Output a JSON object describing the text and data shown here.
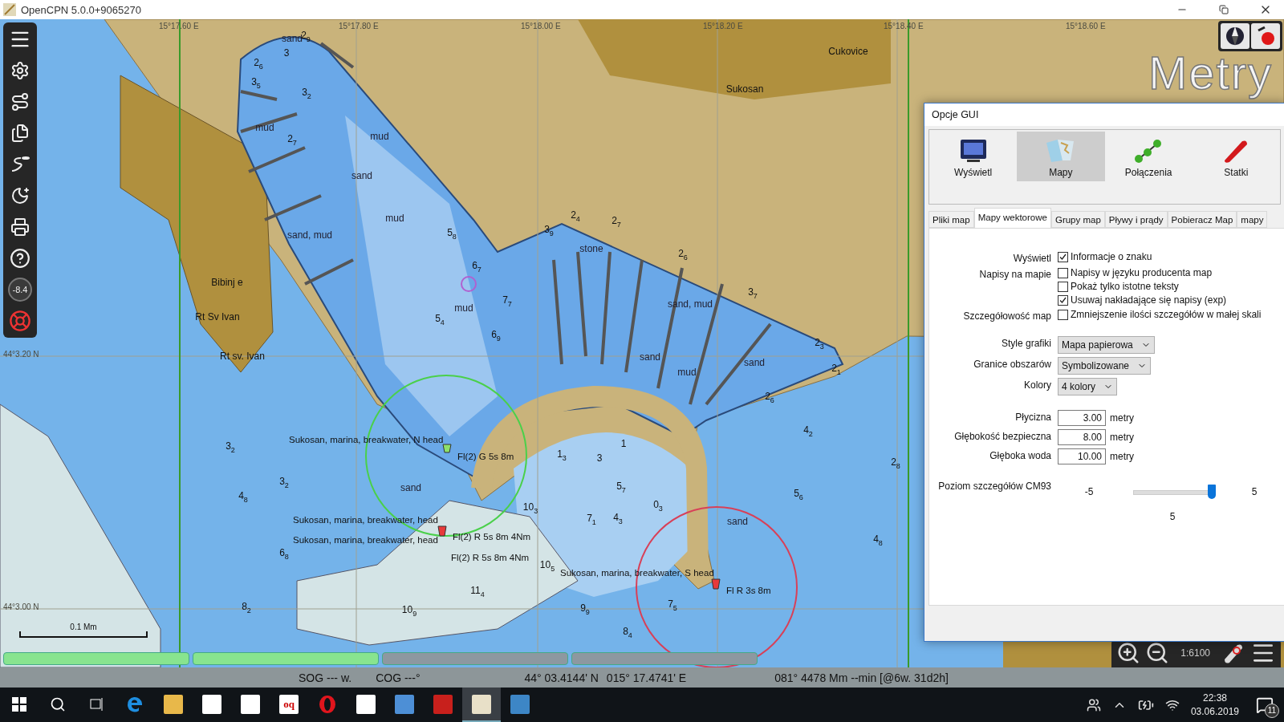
{
  "title_bar": {
    "title": "OpenCPN 5.0.0+9065270"
  },
  "map": {
    "units_overlay": "Metry",
    "labels": [
      {
        "text": "15°17.60 E",
        "kind": "grid"
      },
      {
        "text": "15°17.80 E",
        "kind": "grid"
      },
      {
        "text": "15°18.00 E",
        "kind": "grid"
      },
      {
        "text": "15°18.20 E",
        "kind": "grid"
      },
      {
        "text": "15°18.40 E",
        "kind": "grid"
      },
      {
        "text": "15°18.60 E",
        "kind": "grid"
      },
      {
        "text": "44°3.20 N",
        "kind": "grid"
      },
      {
        "text": "44°3.00 N",
        "kind": "grid"
      },
      {
        "text": "Cukovice",
        "kind": "place"
      },
      {
        "text": "Sukosan",
        "kind": "place"
      },
      {
        "text": "Bibinj e",
        "kind": "place"
      },
      {
        "text": "Rt Sv Ivan",
        "kind": "place"
      },
      {
        "text": "Rt sv. Ivan",
        "kind": "place"
      },
      {
        "text": "Sukosan, marina, breakwater, N head",
        "kind": "light"
      },
      {
        "text": "Fl(2) G 5s 8m",
        "kind": "light"
      },
      {
        "text": "Sukosan, marina, breakwater, head",
        "kind": "light"
      },
      {
        "text": "Sukosan, marina, breakwater, head",
        "kind": "light"
      },
      {
        "text": "Fl(2) R 5s 8m 4Nm",
        "kind": "light"
      },
      {
        "text": "Fl(2) R 5s 8m 4Nm",
        "kind": "light"
      },
      {
        "text": "Sukosan, marina, breakwater, S head",
        "kind": "light"
      },
      {
        "text": "Fl R 3s 8m",
        "kind": "light"
      },
      {
        "text": "sand",
        "kind": "nature"
      },
      {
        "text": "mud",
        "kind": "nature"
      },
      {
        "text": "mud",
        "kind": "nature"
      },
      {
        "text": "sand",
        "kind": "nature"
      },
      {
        "text": "mud",
        "kind": "nature"
      },
      {
        "text": "sand, mud",
        "kind": "nature"
      },
      {
        "text": "mud",
        "kind": "nature"
      },
      {
        "text": "stone",
        "kind": "nature"
      },
      {
        "text": "sand, mud",
        "kind": "nature"
      },
      {
        "text": "sand",
        "kind": "nature"
      },
      {
        "text": "mud",
        "kind": "nature"
      },
      {
        "text": "sand",
        "kind": "nature"
      },
      {
        "text": "sand",
        "kind": "nature"
      },
      {
        "text": "sand",
        "kind": "nature"
      },
      {
        "text": "2$_{9}$",
        "kind": "sounding"
      },
      {
        "text": "3",
        "kind": "sounding"
      },
      {
        "text": "2$_{6}$",
        "kind": "sounding"
      },
      {
        "text": "3$_{5}$",
        "kind": "sounding"
      },
      {
        "text": "3$_{2}$",
        "kind": "sounding"
      },
      {
        "text": "2$_{7}$",
        "kind": "sounding"
      },
      {
        "text": "5$_{8}$",
        "kind": "sounding"
      },
      {
        "text": "6$_{7}$",
        "kind": "sounding"
      },
      {
        "text": "7$_{7}$",
        "kind": "sounding"
      },
      {
        "text": "5$_{4}$",
        "kind": "sounding"
      },
      {
        "text": "6$_{9}$",
        "kind": "sounding"
      },
      {
        "text": "3$_{2}$",
        "kind": "sounding"
      },
      {
        "text": "4$_{8}$",
        "kind": "sounding"
      },
      {
        "text": "3$_{2}$",
        "kind": "sounding"
      },
      {
        "text": "6$_{8}$",
        "kind": "sounding"
      },
      {
        "text": "1$_{3}$",
        "kind": "sounding"
      },
      {
        "text": "3",
        "kind": "sounding"
      },
      {
        "text": "1",
        "kind": "sounding"
      },
      {
        "text": "5$_{7}$",
        "kind": "sounding"
      },
      {
        "text": "7$_{1}$",
        "kind": "sounding"
      },
      {
        "text": "4$_{3}$",
        "kind": "sounding"
      },
      {
        "text": "0$_{3}$",
        "kind": "sounding"
      },
      {
        "text": "9$_{9}$",
        "kind": "sounding"
      },
      {
        "text": "8$_{4}$",
        "kind": "sounding"
      },
      {
        "text": "7$_{5}$",
        "kind": "sounding"
      },
      {
        "text": "5$_{6}$",
        "kind": "sounding"
      },
      {
        "text": "4$_{8}$",
        "kind": "sounding"
      },
      {
        "text": "2$_{8}$",
        "kind": "sounding"
      },
      {
        "text": "4$_{2}$",
        "kind": "sounding"
      },
      {
        "text": "2$_{6}$",
        "kind": "sounding"
      },
      {
        "text": "10$_{9}$",
        "kind": "sounding"
      },
      {
        "text": "11$_{4}$",
        "kind": "sounding"
      },
      {
        "text": "10$_{5}$",
        "kind": "sounding"
      },
      {
        "text": "10$_{3}$",
        "kind": "sounding"
      },
      {
        "text": "8$_{2}$",
        "kind": "sounding"
      },
      {
        "text": "2$_{4}$",
        "kind": "sounding"
      },
      {
        "text": "3$_{9}$",
        "kind": "sounding"
      },
      {
        "text": "2$_{7}$",
        "kind": "sounding"
      },
      {
        "text": "2$_{6}$",
        "kind": "sounding"
      },
      {
        "text": "3$_{7}$",
        "kind": "sounding"
      },
      {
        "text": "2$_{3}$",
        "kind": "sounding"
      },
      {
        "text": "2$_{1}$",
        "kind": "sounding"
      }
    ],
    "scale_label": "0.1 Mm",
    "chart_bar": [
      {
        "selected": true
      },
      {
        "selected": true
      },
      {
        "selected": false
      },
      {
        "selected": false
      }
    ]
  },
  "left_toolbar": {
    "compass_reading": "-8.4"
  },
  "zoom_panel": {
    "scale": "1:6100"
  },
  "dialog": {
    "title": "Opcje GUI",
    "categories": [
      {
        "label": "Wyświetl",
        "kind": "display",
        "selected": false
      },
      {
        "label": "Mapy",
        "kind": "charts",
        "selected": true
      },
      {
        "label": "Połączenia",
        "kind": "connections",
        "selected": false
      },
      {
        "label": "Statki",
        "kind": "ships",
        "selected": false
      }
    ],
    "tabs": [
      {
        "label": "Pliki map",
        "selected": false
      },
      {
        "label": "Mapy wektorowe",
        "selected": true
      },
      {
        "label": "Grupy map",
        "selected": false
      },
      {
        "label": "Pływy i prądy",
        "selected": false
      },
      {
        "label": "Pobieracz Map",
        "selected": false
      },
      {
        "label": "mapy",
        "selected": false
      }
    ],
    "sections": [
      {
        "label": "Wyświetl",
        "kind": "checks",
        "options": [
          {
            "label": "Informacje o znaku",
            "checked": true
          }
        ]
      },
      {
        "label": "Napisy na mapie",
        "kind": "checks",
        "options": [
          {
            "label": "Napisy w języku producenta map",
            "checked": false
          },
          {
            "label": "Pokaż tylko istotne teksty",
            "checked": false
          },
          {
            "label": "Usuwaj nakładające się napisy (exp)",
            "checked": true
          }
        ]
      },
      {
        "label": "Szczegółowość map",
        "kind": "checks",
        "options": [
          {
            "label": "Zmniejszenie ilości szczegółów w małej skali",
            "checked": false
          }
        ]
      },
      {
        "label": "Style grafiki",
        "kind": "select",
        "value": "Mapa papierowa"
      },
      {
        "label": "Granice obszarów",
        "kind": "select",
        "value": "Symbolizowane"
      },
      {
        "label": "Kolory",
        "kind": "select",
        "value": "4 kolory"
      },
      {
        "label": "Płycizna",
        "kind": "number",
        "value": "3.00",
        "unit": "metry"
      },
      {
        "label": "Głębokość bezpieczna",
        "kind": "number",
        "value": "8.00",
        "unit": "metry"
      },
      {
        "label": "Głęboka woda",
        "kind": "number",
        "value": "10.00",
        "unit": "metry"
      },
      {
        "label": "Poziom szczegółów CM93",
        "kind": "slider",
        "min": "-5",
        "max": "5",
        "reading": "5",
        "level": 1
      }
    ]
  },
  "status_bar": {
    "items": [
      "SOG --- w.",
      "COG ---°",
      "44° 03.4144' N",
      "015° 17.4741' E",
      "081°  4478 Mm --min [@6w. 31d2h]"
    ]
  },
  "taskbar": {
    "apps": [
      {
        "kind": "edge",
        "selected": false
      },
      {
        "kind": "folder",
        "selected": false
      },
      {
        "kind": "store",
        "selected": false
      },
      {
        "kind": "mail",
        "selected": false
      },
      {
        "kind": "oq",
        "label": "oq",
        "selected": false
      },
      {
        "kind": "opera",
        "selected": false
      },
      {
        "kind": "calculator",
        "selected": false
      },
      {
        "kind": "thunderbird",
        "selected": false
      },
      {
        "kind": "pdf",
        "selected": false
      },
      {
        "kind": "opencpn",
        "selected": true
      },
      {
        "kind": "writer",
        "selected": false
      }
    ],
    "time": "22:38",
    "date": "03.06.2019",
    "notifications": "11"
  }
}
